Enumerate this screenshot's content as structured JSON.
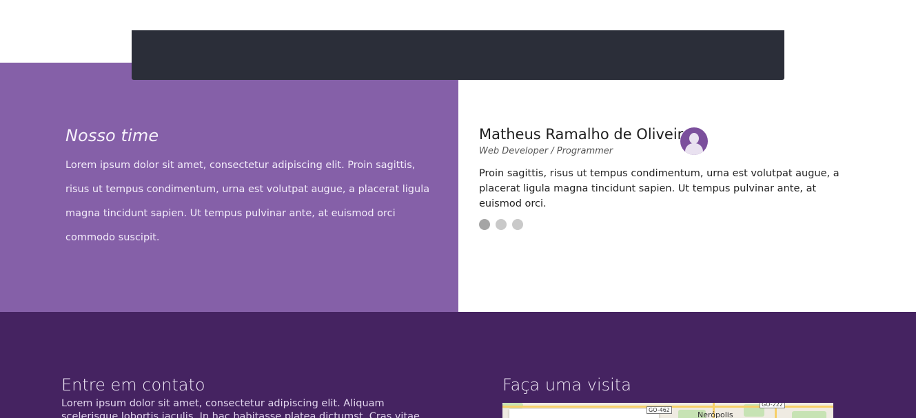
{
  "team": {
    "heading": "Nosso time",
    "text": "Lorem ipsum dolor sit amet, consectetur adipiscing elit. Proin sagittis, risus ut tempus condimentum, urna est volutpat augue, a placerat ligula magna tincidunt sapien. Ut tempus pulvinar ante, at euismod orci commodo suscipit."
  },
  "member": {
    "name": "Matheus Ramalho de Oliveira",
    "role": "Web Developer / Programmer",
    "quote": "Proin sagittis, risus ut tempus condimentum, urna est volutpat augue, a placerat ligula magna tincidunt sapien. Ut tempus pulvinar ante, at euismod orci.",
    "avatar_icon": "user-avatar-icon",
    "slide_count": 3,
    "active_slide": 1
  },
  "contact": {
    "heading": "Entre em contato",
    "text": "Lorem ipsum dolor sit amet, consectetur adipiscing elit. Aliquam scelerisque lobortis iaculis. In hac habitasse platea dictumst. Cras vitae purus metus."
  },
  "visit": {
    "heading": "Faça uma visita",
    "map": {
      "shield_left": "GO-462",
      "shield_right": "GO-222",
      "city": "Nerópolis"
    }
  },
  "colors": {
    "top_bar": "#2b2e39",
    "team_panel": "#8560a8",
    "contact_bg": "#452361",
    "dot_active": "#a5a5a5",
    "dot_inactive": "#c9c9c9"
  }
}
